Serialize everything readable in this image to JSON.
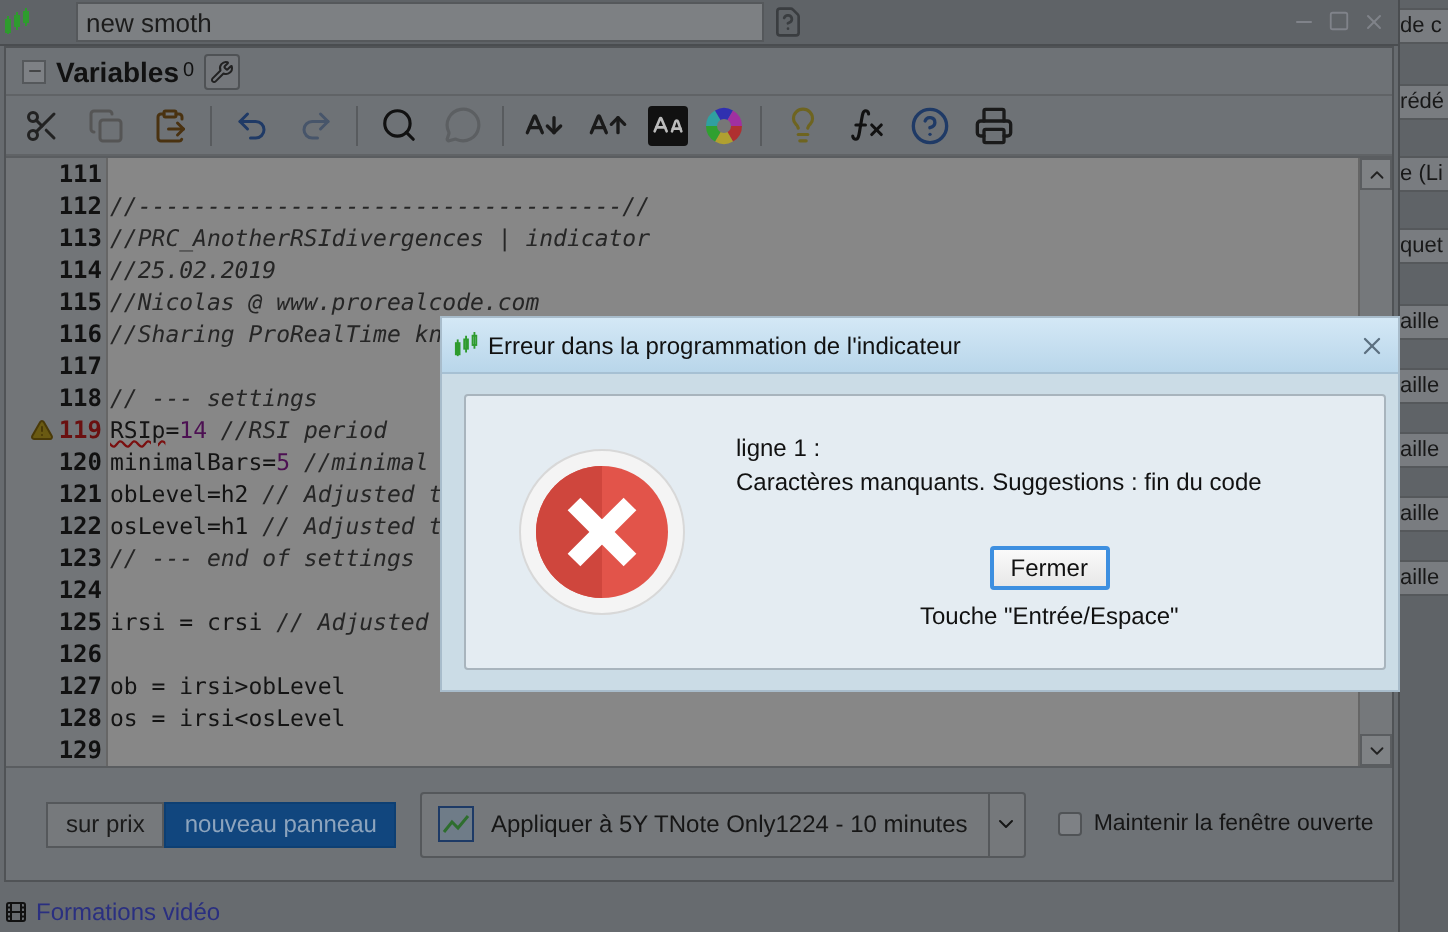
{
  "top_bar": {
    "name_field": "new smoth"
  },
  "right_panel": {
    "items": [
      "de c",
      "rédé",
      "e (Li",
      "quet",
      "aille",
      "aille",
      "aille",
      "aille",
      "aille"
    ]
  },
  "variables": {
    "label": "Variables",
    "count": "0",
    "expanded": true
  },
  "editor": {
    "lines": [
      {
        "number": "111",
        "warning": false
      },
      {
        "number": "112",
        "warning": false,
        "parts": [
          {
            "kind": "comment",
            "text": "//-----------------------------------//"
          }
        ]
      },
      {
        "number": "113",
        "warning": false,
        "parts": [
          {
            "kind": "comment",
            "text": "//PRC_AnotherRSIdivergences | indicator"
          }
        ]
      },
      {
        "number": "114",
        "warning": false,
        "parts": [
          {
            "kind": "comment",
            "text": "//25.02.2019"
          }
        ]
      },
      {
        "number": "115",
        "warning": false,
        "parts": [
          {
            "kind": "comment",
            "text": "//Nicolas @ www.prorealcode.com"
          }
        ]
      },
      {
        "number": "116",
        "warning": false,
        "parts": [
          {
            "kind": "comment",
            "text": "//Sharing ProRealTime kn"
          }
        ]
      },
      {
        "number": "117",
        "warning": false
      },
      {
        "number": "118",
        "warning": false,
        "parts": [
          {
            "kind": "comment",
            "text": "// --- settings"
          }
        ]
      },
      {
        "number": "119",
        "warning": true,
        "parts": [
          {
            "kind": "error",
            "text": "RSIp"
          },
          {
            "kind": "code",
            "text": "="
          },
          {
            "kind": "number",
            "text": "14"
          },
          {
            "kind": "comment",
            "text": " //RSI period"
          }
        ]
      },
      {
        "number": "120",
        "warning": false,
        "parts": [
          {
            "kind": "code",
            "text": "minimalBars="
          },
          {
            "kind": "number",
            "text": "5"
          },
          {
            "kind": "comment",
            "text": " //minimal"
          }
        ]
      },
      {
        "number": "121",
        "warning": false,
        "parts": [
          {
            "kind": "code",
            "text": "obLevel=h2"
          },
          {
            "kind": "comment",
            "text": " // Adjusted t"
          }
        ]
      },
      {
        "number": "122",
        "warning": false,
        "parts": [
          {
            "kind": "code",
            "text": "osLevel=h1"
          },
          {
            "kind": "comment",
            "text": " // Adjusted t"
          }
        ]
      },
      {
        "number": "123",
        "warning": false,
        "parts": [
          {
            "kind": "comment",
            "text": "// --- end of settings"
          }
        ]
      },
      {
        "number": "124",
        "warning": false
      },
      {
        "number": "125",
        "warning": false,
        "parts": [
          {
            "kind": "code",
            "text": "irsi = crsi"
          },
          {
            "kind": "comment",
            "text": " // Adjusted"
          }
        ]
      },
      {
        "number": "126",
        "warning": false
      },
      {
        "number": "127",
        "warning": false,
        "parts": [
          {
            "kind": "code",
            "text": "ob = irsi>obLevel"
          }
        ]
      },
      {
        "number": "128",
        "warning": false,
        "parts": [
          {
            "kind": "code",
            "text": "os = irsi<osLevel"
          }
        ]
      },
      {
        "number": "129",
        "warning": false
      }
    ]
  },
  "target_buttons": [
    {
      "label": "sur prix",
      "selected": false
    },
    {
      "label": "nouveau panneau",
      "selected": true
    }
  ],
  "apply": {
    "label": "Appliquer à 5Y TNote Only1224 - 10 minutes"
  },
  "keep_open": {
    "label": "Maintenir la fenêtre ouverte",
    "checked": false
  },
  "video_link": "Formations vidéo",
  "dialog": {
    "title": "Erreur dans la programmation de l'indicateur",
    "line": "ligne 1 :",
    "message": "Caractères manquants. Suggestions : fin du code",
    "button": "Fermer",
    "hint": "Touche \"Entrée/Espace\""
  }
}
